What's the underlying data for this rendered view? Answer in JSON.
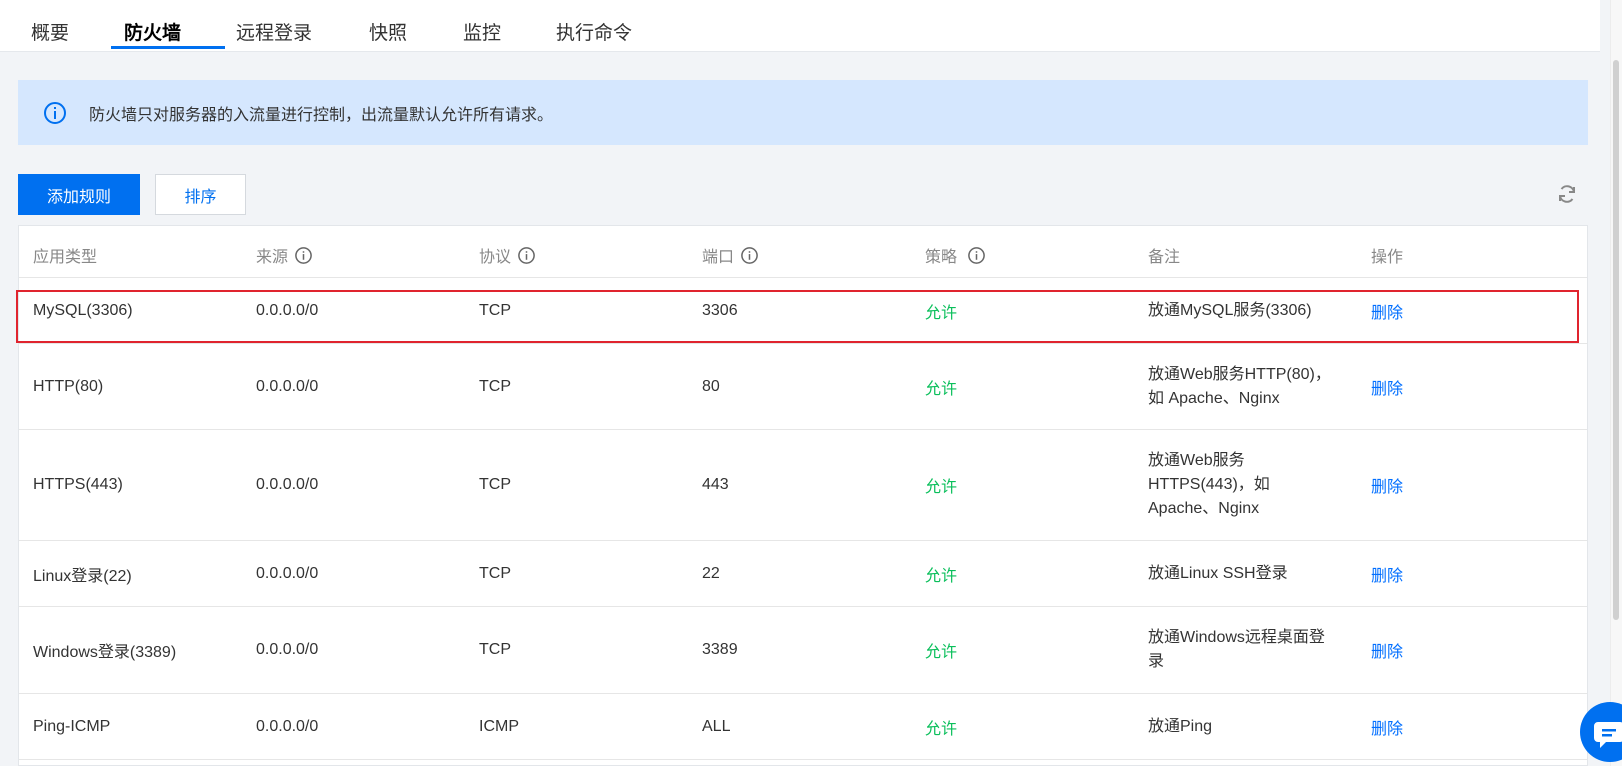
{
  "tabs": [
    {
      "label": "概要"
    },
    {
      "label": "防火墙"
    },
    {
      "label": "远程登录"
    },
    {
      "label": "快照"
    },
    {
      "label": "监控"
    },
    {
      "label": "执行命令"
    }
  ],
  "active_tab": "防火墙",
  "notice": {
    "text": "防火墙只对服务器的入流量进行控制，出流量默认允许所有请求。",
    "icon": "info-icon"
  },
  "toolbar": {
    "add_rule": "添加规则",
    "sort": "排序",
    "refresh_icon": "refresh-icon"
  },
  "table": {
    "headers": {
      "app_type": "应用类型",
      "source": "来源",
      "protocol": "协议",
      "port": "端口",
      "policy": "策略",
      "note": "备注",
      "action": "操作"
    },
    "rows": [
      {
        "app_type": "MySQL(3306)",
        "source": "0.0.0.0/0",
        "protocol": "TCP",
        "port": "3306",
        "policy": "允许",
        "note": "放通MySQL服务(3306)",
        "action": "删除"
      },
      {
        "app_type": "HTTP(80)",
        "source": "0.0.0.0/0",
        "protocol": "TCP",
        "port": "80",
        "policy": "允许",
        "note": "放通Web服务HTTP(80)，如 Apache、Nginx",
        "action": "删除"
      },
      {
        "app_type": "HTTPS(443)",
        "source": "0.0.0.0/0",
        "protocol": "TCP",
        "port": "443",
        "policy": "允许",
        "note": "放通Web服务HTTPS(443)，如Apache、Nginx",
        "action": "删除"
      },
      {
        "app_type": "Linux登录(22)",
        "source": "0.0.0.0/0",
        "protocol": "TCP",
        "port": "22",
        "policy": "允许",
        "note": "放通Linux SSH登录",
        "action": "删除"
      },
      {
        "app_type": "Windows登录(3389)",
        "source": "0.0.0.0/0",
        "protocol": "TCP",
        "port": "3389",
        "policy": "允许",
        "note": "放通Windows远程桌面登录",
        "action": "删除"
      },
      {
        "app_type": "Ping-ICMP",
        "source": "0.0.0.0/0",
        "protocol": "ICMP",
        "port": "ALL",
        "policy": "允许",
        "note": "放通Ping",
        "action": "删除"
      }
    ]
  },
  "colors": {
    "primary": "#0070f0",
    "allow": "#0abf5b",
    "highlight": "#e0242e",
    "notice_bg": "#d5e7fe"
  }
}
